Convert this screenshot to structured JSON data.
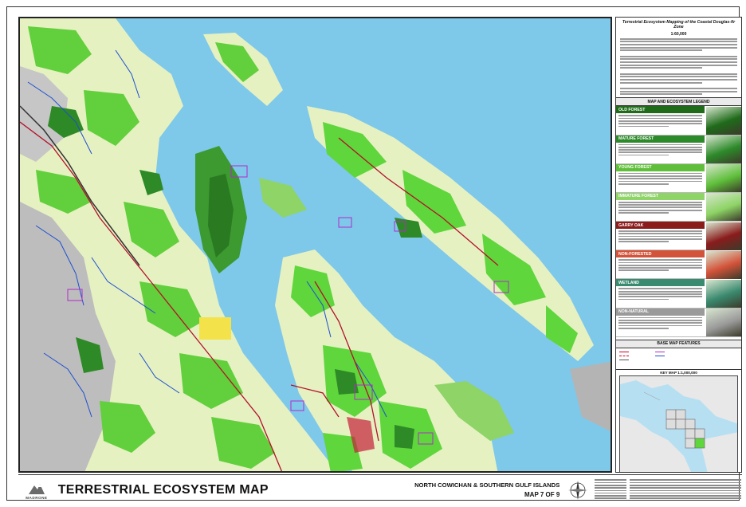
{
  "legend_panel": {
    "title": "Terrestrial Ecosystem Mapping of the Coastal Douglas-fir Zone",
    "scale": "1:60,000",
    "legend_heading": "MAP AND ECOSYSTEM LEGEND",
    "categories": [
      {
        "label": "OLD FOREST",
        "color": "#1f6b1a"
      },
      {
        "label": "MATURE FOREST",
        "color": "#2d8a2a"
      },
      {
        "label": "YOUNG FOREST",
        "color": "#5fbf3a"
      },
      {
        "label": "IMMATURE FOREST",
        "color": "#8ed466"
      },
      {
        "label": "GARRY OAK",
        "color": "#8a1c1c"
      },
      {
        "label": "NON-FORESTED",
        "color": "#d3533a"
      },
      {
        "label": "WETLAND",
        "color": "#3a8a70"
      },
      {
        "label": "NON-NATURAL",
        "color": "#9a9a9a"
      }
    ],
    "base_heading": "BASE MAP FEATURES",
    "keymap_heading": "KEY MAP 1:1,000,000"
  },
  "footer": {
    "logo_text": "MADRONE",
    "title": "TERRESTRIAL ECOSYSTEM MAP",
    "area": "NORTH COWICHAN & SOUTHERN GULF ISLANDS",
    "map_number": "MAP 7 OF 9"
  },
  "colors": {
    "water": "#7ec8ea",
    "land_pale": "#e8f3c4",
    "land_green": "#8ed466",
    "bright_green": "#5fd63c",
    "dark_forest": "#2e8a26",
    "grey": "#b4b4b4",
    "road_red": "#b3102a",
    "boundary_purple": "#b02bc8",
    "stream_blue": "#1c4fd1"
  }
}
